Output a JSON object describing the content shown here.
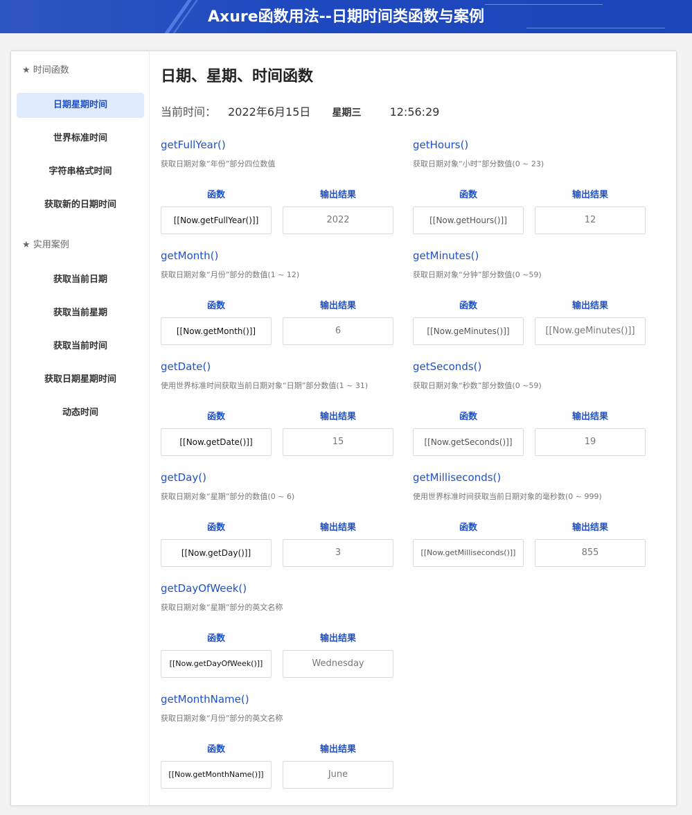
{
  "header": {
    "title": "Axure函数用法--日期时间类函数与案例"
  },
  "sidebar": {
    "section1": "★ 时间函数",
    "items1": [
      "日期星期时间",
      "世界标准时间",
      "字符串格式时间",
      "获取新的日期时间"
    ],
    "section2": "★ 实用案例",
    "items2": [
      "获取当前日期",
      "获取当前星期",
      "获取当前时间",
      "获取日期星期时间",
      "动态时间"
    ],
    "active": "日期星期时间"
  },
  "main": {
    "title": "日期、星期、时间函数",
    "now_label": "当前时间：",
    "now_date": "2022年6月15日",
    "now_weekday": "星期三",
    "now_time": "12:56:29",
    "col_fn": "函数",
    "col_out": "输出结果",
    "functions": [
      {
        "name": "getFullYear()",
        "desc": "获取日期对象“年份”部分四位数值",
        "expr": "[[Now.getFullYear()]]",
        "out": "2022"
      },
      {
        "name": "getHours()",
        "desc": "获取日期对象“小时”部分数值(0 ~ 23)",
        "expr": "[[Now.getHours()]]",
        "out": "12"
      },
      {
        "name": "getMonth()",
        "desc": "获取日期对象“月份”部分的数值(1 ~ 12)",
        "expr": "[[Now.getMonth()]]",
        "out": "6"
      },
      {
        "name": "getMinutes()",
        "desc": "获取日期对象“分钟”部分数值(0 ~59)",
        "expr": "[[Now.geMinutes()]]",
        "out": "[[Now.geMinutes()]]"
      },
      {
        "name": "getDate()",
        "desc": "使用世界标准时间获取当前日期对象“日期”部分数值(1 ~ 31)",
        "expr": "[[Now.getDate()]]",
        "out": "15"
      },
      {
        "name": "getSeconds()",
        "desc": "获取日期对象“秒数”部分数值(0 ~59)",
        "expr": "[[Now.getSeconds()]]",
        "out": "19"
      },
      {
        "name": "getDay()",
        "desc": "获取日期对象“星期”部分的数值(0 ~ 6)",
        "expr": "[[Now.getDay()]]",
        "out": "3"
      },
      {
        "name": "getMilliseconds()",
        "desc": "使用世界标准时间获取当前日期对象的毫秒数(0 ~ 999)",
        "expr": "[[Now.getMilliseconds()]]",
        "out": "855"
      },
      {
        "name": "getDayOfWeek()",
        "desc": "获取日期对象“星期”部分的英文名称",
        "expr": "[[Now.getDayOfWeek()]]",
        "out": "Wednesday"
      },
      {
        "name": "getMonthName()",
        "desc": "获取日期对象“月份”部分的英文名称",
        "expr": "[[Now.getMonthName()]]",
        "out": "June"
      }
    ]
  },
  "colors": {
    "accent": "#1e50c8",
    "active_bg": "#dfeafd",
    "header_bg": "#1f49bf"
  }
}
